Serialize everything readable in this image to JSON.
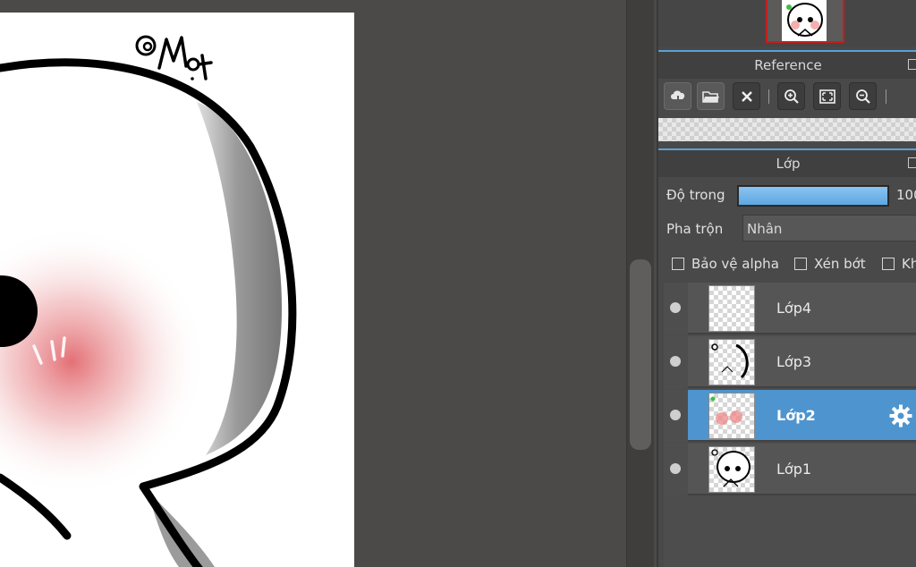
{
  "canvas": {
    "signature": "@Mọt"
  },
  "reference": {
    "title": "Reference",
    "tools": [
      {
        "icon": "cloud-import-icon"
      },
      {
        "icon": "folder-open-icon"
      },
      {
        "icon": "close-icon"
      },
      {
        "icon": "zoom-in-icon"
      },
      {
        "icon": "fit-screen-icon"
      },
      {
        "icon": "zoom-out-icon"
      }
    ]
  },
  "layer_panel": {
    "title": "Lớp",
    "opacity_label": "Độ trong",
    "opacity_value": "100",
    "opacity_fraction": 0.99,
    "blend_label": "Pha trộn",
    "blend_value": "Nhân",
    "options": [
      "Bảo vệ alpha",
      "Xén bớt",
      "Kh"
    ]
  },
  "layers": [
    {
      "name": "Lớp4",
      "selected": false
    },
    {
      "name": "Lớp3",
      "selected": false
    },
    {
      "name": "Lớp2",
      "selected": true
    },
    {
      "name": "Lớp1",
      "selected": false
    }
  ],
  "colors": {
    "accent": "#4e95cf",
    "panel_bg": "#4a4949",
    "workspace_bg": "#4b4a49",
    "navigator_frame": "#c61d1d"
  }
}
